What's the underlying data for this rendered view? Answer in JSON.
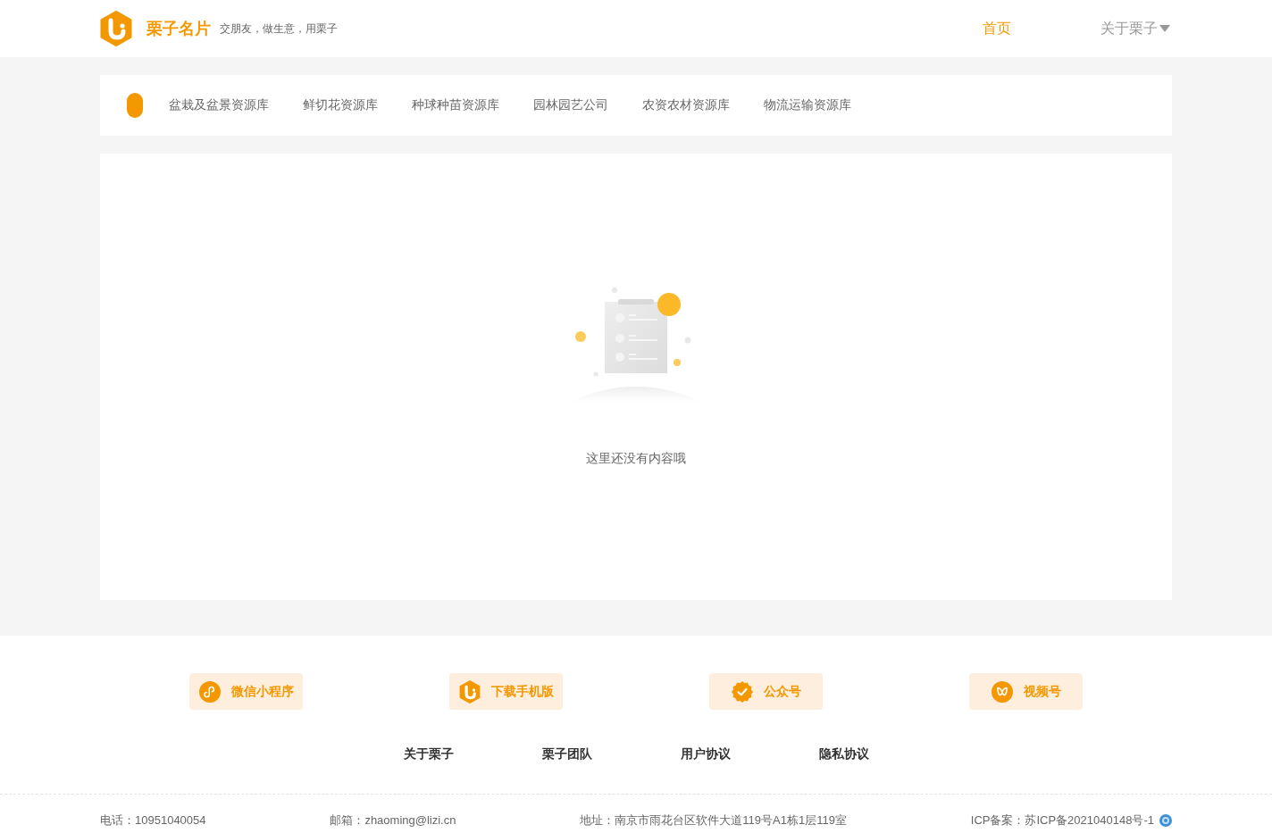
{
  "header": {
    "brand": "栗子名片",
    "slogan": "交朋友，做生意，用栗子",
    "nav": [
      {
        "label": "首页",
        "kind": "link",
        "selected": true
      },
      {
        "label": "关于栗子",
        "kind": "dropdown",
        "selected": false
      }
    ]
  },
  "categories": {
    "items": [
      "盆栽及盆景资源库",
      "鲜切花资源库",
      "种球种苗资源库",
      "园林园艺公司",
      "农资农材资源库",
      "物流运输资源库"
    ]
  },
  "content": {
    "empty_message": "这里还没有内容哦"
  },
  "footer": {
    "apps": [
      {
        "label": "微信小程序",
        "kind": "miniprogram"
      },
      {
        "label": "下载手机版",
        "kind": "app"
      },
      {
        "label": "公众号",
        "kind": "official"
      },
      {
        "label": "视频号",
        "kind": "channels"
      }
    ],
    "links": [
      "关于栗子",
      "栗子团队",
      "用户协议",
      "隐私协议"
    ],
    "contacts": [
      {
        "text": "电话：10951040054",
        "kind": "text"
      },
      {
        "text": "邮箱：zhaoming@lizi.cn",
        "kind": "text"
      },
      {
        "text": "地址：南京市雨花台区软件大道119号A1栋1层119室",
        "kind": "text"
      },
      {
        "text": "ICP备案：苏ICP备2021040148号-1",
        "kind": "record"
      }
    ]
  }
}
